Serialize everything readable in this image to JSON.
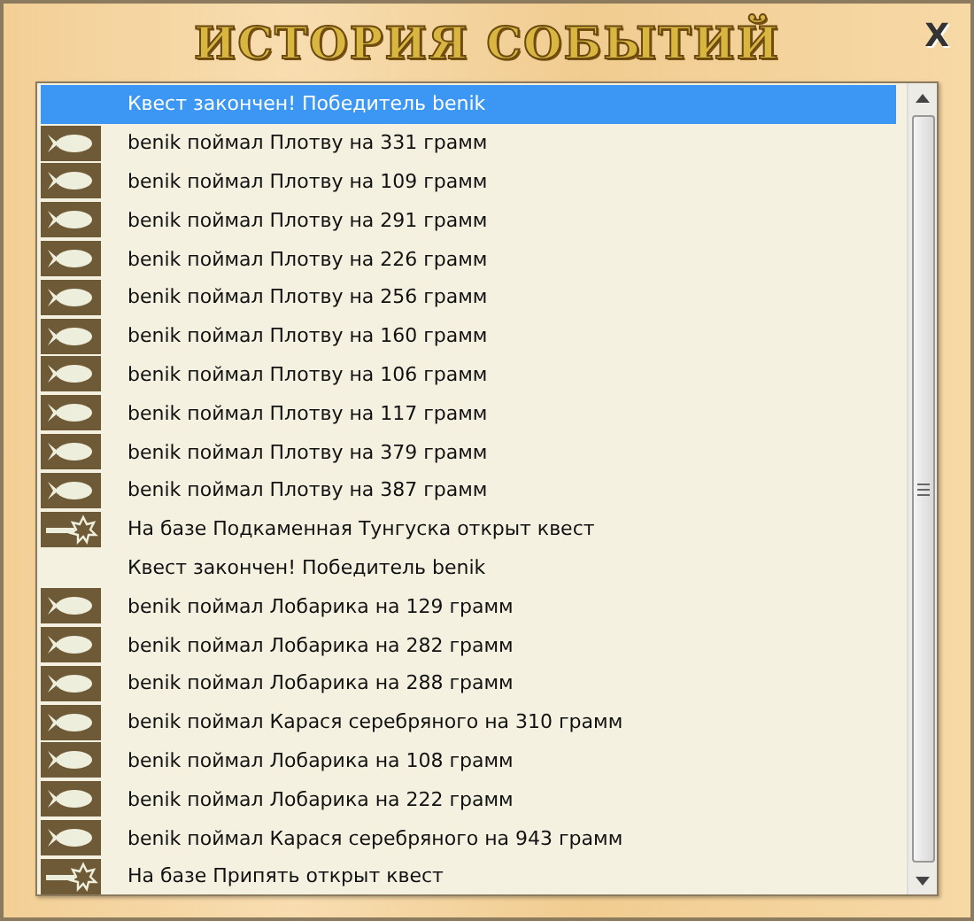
{
  "window": {
    "title": "ИСТОРИЯ СОБЫТИЙ",
    "close": "X"
  },
  "events": [
    {
      "kind": "none",
      "text": "Квест закончен! Победитель benik",
      "selected": true
    },
    {
      "kind": "fish",
      "text": "benik поймал Плотву на 331 грамм",
      "selected": false
    },
    {
      "kind": "fish",
      "text": "benik поймал Плотву на 109 грамм",
      "selected": false
    },
    {
      "kind": "fish",
      "text": "benik поймал Плотву на 291 грамм",
      "selected": false
    },
    {
      "kind": "fish",
      "text": "benik поймал Плотву на 226 грамм",
      "selected": false
    },
    {
      "kind": "fish",
      "text": "benik поймал Плотву на 256 грамм",
      "selected": false
    },
    {
      "kind": "fish",
      "text": "benik поймал Плотву на 160 грамм",
      "selected": false
    },
    {
      "kind": "fish",
      "text": "benik поймал Плотву на 106 грамм",
      "selected": false
    },
    {
      "kind": "fish",
      "text": "benik поймал Плотву на 117 грамм",
      "selected": false
    },
    {
      "kind": "fish",
      "text": "benik поймал Плотву на 379 грамм",
      "selected": false
    },
    {
      "kind": "fish",
      "text": "benik поймал Плотву на 387 грамм",
      "selected": false
    },
    {
      "kind": "quest",
      "text": "На базе Подкаменная Тунгуска открыт квест",
      "selected": false
    },
    {
      "kind": "none",
      "text": "Квест закончен! Победитель benik",
      "selected": false
    },
    {
      "kind": "fish",
      "text": "benik поймал Лобарика на 129 грамм",
      "selected": false
    },
    {
      "kind": "fish",
      "text": "benik поймал Лобарика на 282 грамм",
      "selected": false
    },
    {
      "kind": "fish",
      "text": "benik поймал Лобарика на 288 грамм",
      "selected": false
    },
    {
      "kind": "fish",
      "text": "benik поймал Карася серебряного на 310 грамм",
      "selected": false
    },
    {
      "kind": "fish",
      "text": "benik поймал Лобарика на 108 грамм",
      "selected": false
    },
    {
      "kind": "fish",
      "text": "benik поймал Лобарика на 222 грамм",
      "selected": false
    },
    {
      "kind": "fish",
      "text": "benik поймал Карася серебряного на 943 грамм",
      "selected": false
    },
    {
      "kind": "quest",
      "text": "На базе Припять открыт квест",
      "selected": false
    }
  ]
}
